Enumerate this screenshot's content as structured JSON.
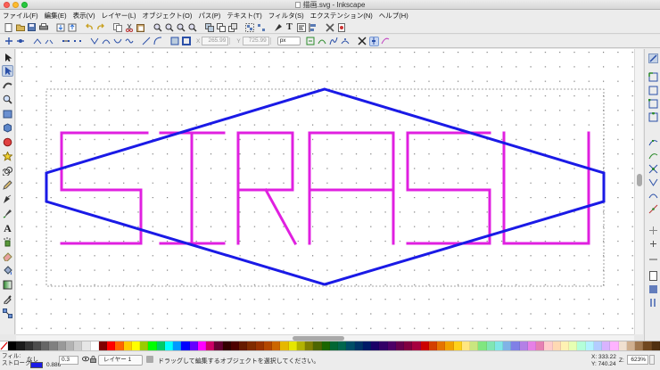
{
  "window": {
    "title": "描画.svg - Inkscape"
  },
  "menu": [
    "ファイル(F)",
    "編集(E)",
    "表示(V)",
    "レイヤー(L)",
    "オブジェクト(O)",
    "パス(P)",
    "テキスト(T)",
    "フィルタ(S)",
    "エクステンション(N)",
    "ヘルプ(H)"
  ],
  "tool_controls": {
    "x_label": "X",
    "x_value": "265.99",
    "y_label": "Y",
    "y_value": "725.99",
    "unit": "px"
  },
  "canvas": {
    "text_color": "#e020e0",
    "path_color": "#1a1ae6",
    "selection_dash_color": "#888888"
  },
  "status": {
    "fill_label": "フィル:",
    "stroke_label": "ストローク:",
    "fill_value": "なし",
    "stroke_width": "0.886",
    "opacity": "0.3",
    "layer": "レイヤー 1",
    "message": "ドラッグして編集するオブジェクトを選択してください。",
    "x_label": "X:",
    "x_value": "333.22",
    "y_label": "Y:",
    "y_value": "740.24",
    "zoom_label": "Z:",
    "zoom": "623%"
  },
  "palette": [
    "#000000",
    "#1a1a1a",
    "#333333",
    "#4d4d4d",
    "#666666",
    "#808080",
    "#999999",
    "#b3b3b3",
    "#cccccc",
    "#e6e6e6",
    "#ffffff",
    "#800000",
    "#ff0000",
    "#ff6600",
    "#ffcc00",
    "#ffff00",
    "#99cc00",
    "#00ff00",
    "#00cc66",
    "#00ffff",
    "#0099ff",
    "#0000ff",
    "#6600ff",
    "#ff00ff",
    "#cc0066",
    "#660033",
    "#330000",
    "#4d0000",
    "#661a00",
    "#802b00",
    "#993300",
    "#b34700",
    "#cc6600",
    "#e6b800",
    "#e6e600",
    "#b3b300",
    "#808000",
    "#4d6600",
    "#1a6600",
    "#006633",
    "#00664d",
    "#004d66",
    "#003366",
    "#001a66",
    "#1a0066",
    "#330066",
    "#4d0066",
    "#66004d",
    "#800040",
    "#a6003f",
    "#cc0000",
    "#d43f00",
    "#e67300",
    "#f2a200",
    "#ffd11a",
    "#ffe680",
    "#c9e680",
    "#80e680",
    "#80e6b3",
    "#80e6e6",
    "#80b3e6",
    "#8080e6",
    "#b380e6",
    "#e680e6",
    "#e680b3",
    "#ffcccc",
    "#ffd9b3",
    "#fff2b3",
    "#e6ffb3",
    "#b3ffd9",
    "#b3f2ff",
    "#b3ccff",
    "#d9b3ff",
    "#ffb3ff",
    "#f0e0d0",
    "#d0b090",
    "#a07850",
    "#704820",
    "#503010"
  ]
}
